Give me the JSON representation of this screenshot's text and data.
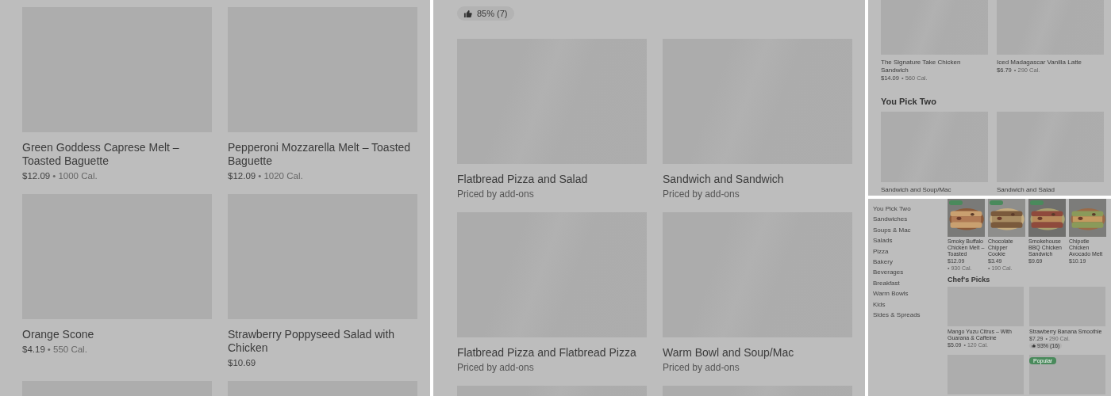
{
  "menu_grid": {
    "items": [
      {
        "kind": "item",
        "title": "Green Goddess Caprese Melt – Toasted Baguette",
        "price": "$12.09",
        "calories": "• 1000 Cal."
      },
      {
        "kind": "item",
        "title": "Pepperoni Mozzarella Melt – Toasted Baguette",
        "price": "$12.09",
        "calories": "• 1020 Cal."
      },
      {
        "kind": "item",
        "title": "Orange Scone",
        "price": "$4.19",
        "calories": "• 550 Cal."
      },
      {
        "kind": "item",
        "title": "Strawberry Poppyseed Salad with Chicken",
        "price": "$10.69"
      },
      {
        "kind": "image_only"
      },
      {
        "kind": "image_only"
      }
    ]
  },
  "combo_grid": {
    "rating": "85% (7)",
    "items": [
      {
        "kind": "item",
        "title": "Flatbread Pizza and Salad",
        "subtitle": "Priced by add-ons"
      },
      {
        "kind": "item",
        "title": "Sandwich and Sandwich",
        "subtitle": "Priced by add-ons"
      },
      {
        "kind": "item",
        "title": "Flatbread Pizza and Flatbread Pizza",
        "subtitle": "Priced by add-ons"
      },
      {
        "kind": "item",
        "title": "Warm Bowl and Soup/Mac",
        "subtitle": "Priced by add-ons"
      },
      {
        "kind": "image_only"
      },
      {
        "kind": "image_only"
      }
    ]
  },
  "mobile_menu": {
    "items": [
      {
        "kind": "item",
        "title": "The Signature Take Chicken Sandwich",
        "price": "$14.09",
        "calories": "• 560 Cal."
      },
      {
        "kind": "item",
        "title": "Iced Madagascar Vanilla Latte",
        "price": "$6.79",
        "calories": "• 290 Cal."
      }
    ],
    "section": {
      "title": "You Pick Two",
      "items": [
        {
          "kind": "item",
          "title": "Sandwich and Soup/Mac"
        },
        {
          "kind": "item",
          "title": "Sandwich and Salad"
        }
      ]
    }
  },
  "store_page": {
    "sidebar": {
      "items": [
        "You Pick Two",
        "Sandwiches",
        "Soups & Mac",
        "Salads",
        "Pizza",
        "Bakery",
        "Beverages",
        "Breakfast",
        "Warm Bowls",
        "Kids",
        "Sides & Spreads"
      ]
    },
    "featured": [
      {
        "title": "Smoky Buffalo Chicken Melt – Toasted",
        "price": "$12.09",
        "calories": "• 930 Cal.",
        "badge": true
      },
      {
        "title": "Chocolate Chipper Cookie",
        "price": "$3.49",
        "calories": "• 190 Cal.",
        "badge": true
      },
      {
        "title": "Smokehouse BBQ Chicken Sandwich",
        "price": "$9.69",
        "badge": true
      },
      {
        "title": "Chipotle Chicken Avocado Melt",
        "price": "$10.19",
        "badge": false
      }
    ],
    "chefs_picks": {
      "title": "Chef's Picks",
      "items": [
        {
          "kind": "item",
          "title": "Mango Yuzu Citrus – With Guarana & Caffeine",
          "price": "$5.09",
          "calories": "• 120 Cal."
        },
        {
          "kind": "item",
          "title": "Strawberry Banana Smoothie",
          "price": "$7.29",
          "calories": "• 290 Cal.",
          "rating": "93% (16)"
        },
        {
          "kind": "image_only"
        },
        {
          "kind": "image_only",
          "tag": "Popular"
        }
      ]
    }
  }
}
